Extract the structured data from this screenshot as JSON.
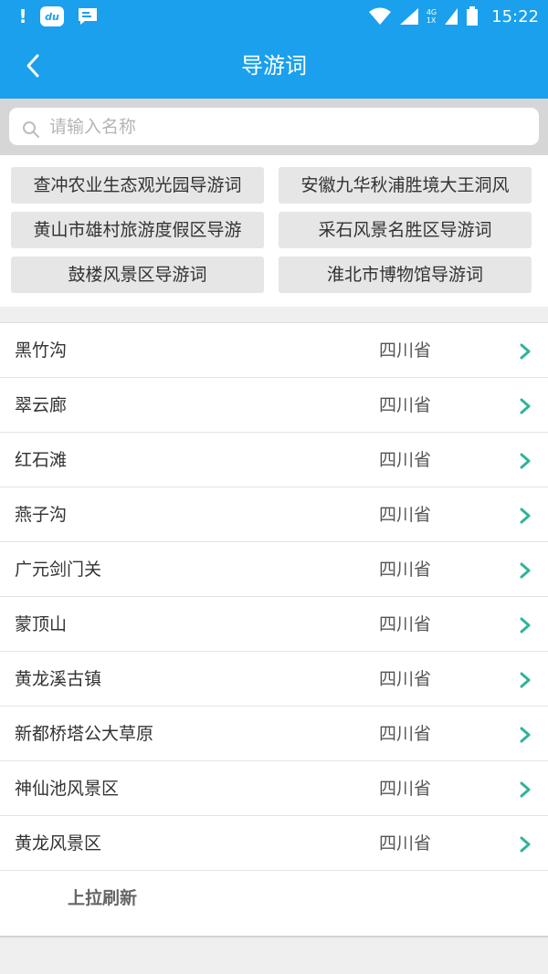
{
  "status_bar": {
    "time": "15:22",
    "alert_glyph": "!",
    "app_badge_text": "du",
    "network_label": "4G",
    "network_sub": "1X",
    "icons": [
      "alert-icon",
      "du-app-icon",
      "message-icon",
      "wifi-icon",
      "signal-icon",
      "signal-4g-icon",
      "battery-icon"
    ]
  },
  "header": {
    "title": "导游词",
    "back_icon": "chevron-left-icon"
  },
  "search": {
    "placeholder": "请输入名称",
    "value": "",
    "icon": "search-icon"
  },
  "hot_tags": [
    "查冲农业生态观光园导游词",
    "安徽九华秋浦胜境大王洞风",
    "黄山市雄村旅游度假区导游",
    "采石风景名胜区导游词",
    "鼓楼风景区导游词",
    "淮北市博物馆导游词"
  ],
  "list": {
    "items": [
      {
        "name": "黑竹沟",
        "province": "四川省"
      },
      {
        "name": "翠云廊",
        "province": "四川省"
      },
      {
        "name": "红石滩",
        "province": "四川省"
      },
      {
        "name": "燕子沟",
        "province": "四川省"
      },
      {
        "name": "广元剑门关",
        "province": "四川省"
      },
      {
        "name": "蒙顶山",
        "province": "四川省"
      },
      {
        "name": "黄龙溪古镇",
        "province": "四川省"
      },
      {
        "name": "新都桥塔公大草原",
        "province": "四川省"
      },
      {
        "name": "神仙池风景区",
        "province": "四川省"
      },
      {
        "name": "黄龙风景区",
        "province": "四川省"
      }
    ],
    "load_more_label": "上拉刷新"
  },
  "colors": {
    "primary": "#1aa0ec",
    "chevron": "#2fb39a",
    "tag_bg": "#e6e6e6"
  }
}
